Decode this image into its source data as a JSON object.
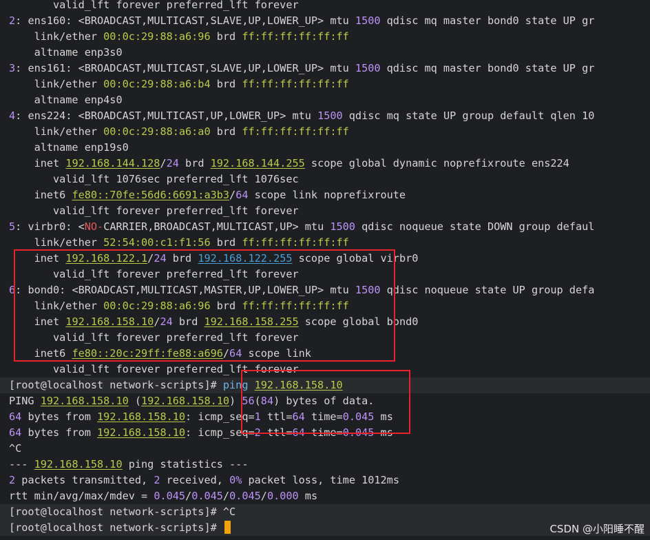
{
  "terminal": {
    "lines": [
      [
        [
          "d",
          "       valid_lft forever preferred_lft forever"
        ]
      ],
      [
        [
          "n",
          "2"
        ],
        [
          "d",
          ": ens160: <BROADCAST,MULTICAST,SLAVE,UP,LOWER_UP> mtu "
        ],
        [
          "n",
          "1500"
        ],
        [
          "d",
          " qdisc mq master bond0 state UP gr"
        ]
      ],
      [
        [
          "d",
          "    link/ether "
        ],
        [
          "g2",
          "00:0c:29:88:a6:96"
        ],
        [
          "d",
          " brd "
        ],
        [
          "g2",
          "ff:ff:ff:ff:ff:ff"
        ]
      ],
      [
        [
          "d",
          "    altname enp3s0"
        ]
      ],
      [
        [
          "n",
          "3"
        ],
        [
          "d",
          ": ens161: <BROADCAST,MULTICAST,SLAVE,UP,LOWER_UP> mtu "
        ],
        [
          "n",
          "1500"
        ],
        [
          "d",
          " qdisc mq master bond0 state UP gr"
        ]
      ],
      [
        [
          "d",
          "    link/ether "
        ],
        [
          "g2",
          "00:0c:29:88:a6:b4"
        ],
        [
          "d",
          " brd "
        ],
        [
          "g2",
          "ff:ff:ff:ff:ff:ff"
        ]
      ],
      [
        [
          "d",
          "    altname enp4s0"
        ]
      ],
      [
        [
          "n",
          "4"
        ],
        [
          "d",
          ": ens224: <BROADCAST,MULTICAST,UP,LOWER_UP> mtu "
        ],
        [
          "n",
          "1500"
        ],
        [
          "d",
          " qdisc mq state UP group default qlen 10"
        ]
      ],
      [
        [
          "d",
          "    link/ether "
        ],
        [
          "g2",
          "00:0c:29:88:a6:a0"
        ],
        [
          "d",
          " brd "
        ],
        [
          "g2",
          "ff:ff:ff:ff:ff:ff"
        ]
      ],
      [
        [
          "d",
          "    altname enp19s0"
        ]
      ],
      [
        [
          "d",
          "    inet "
        ],
        [
          "g",
          "192.168.144.128"
        ],
        [
          "d",
          "/"
        ],
        [
          "n",
          "24"
        ],
        [
          "d",
          " brd "
        ],
        [
          "g",
          "192.168.144.255"
        ],
        [
          "d",
          " scope global dynamic noprefixroute ens224"
        ]
      ],
      [
        [
          "d",
          "       valid_lft 1076sec preferred_lft 1076sec"
        ]
      ],
      [
        [
          "d",
          "    inet6 "
        ],
        [
          "g",
          "fe80::70fe:56d6:6691:a3b3"
        ],
        [
          "d",
          "/"
        ],
        [
          "n",
          "64"
        ],
        [
          "d",
          " scope link noprefixroute"
        ]
      ],
      [
        [
          "d",
          "       valid_lft forever preferred_lft forever"
        ]
      ],
      [
        [
          "n",
          "5"
        ],
        [
          "d",
          ": virbr0: <"
        ],
        [
          "r",
          "NO-"
        ],
        [
          "d",
          "CARRIER,BROADCAST,MULTICAST,UP> mtu "
        ],
        [
          "n",
          "1500"
        ],
        [
          "d",
          " qdisc noqueue state DOWN group defaul"
        ]
      ],
      [
        [
          "d",
          "    link/ether "
        ],
        [
          "g2",
          "52:54:00:c1:f1:56"
        ],
        [
          "d",
          " brd "
        ],
        [
          "g2",
          "ff:ff:ff:ff:ff:ff"
        ]
      ],
      [
        [
          "d",
          "    inet "
        ],
        [
          "g",
          "192.168.122.1"
        ],
        [
          "d",
          "/"
        ],
        [
          "n",
          "24"
        ],
        [
          "d",
          " brd "
        ],
        [
          "b",
          "192.168.122.255"
        ],
        [
          "d",
          " scope global virbr0"
        ]
      ],
      [
        [
          "d",
          "       valid_lft forever preferred_lft forever"
        ]
      ],
      [
        [
          "n",
          "6"
        ],
        [
          "d",
          ": bond0: <BROADCAST,MULTICAST,MASTER,UP,LOWER_UP> mtu "
        ],
        [
          "n",
          "1500"
        ],
        [
          "d",
          " qdisc noqueue state UP group defa"
        ]
      ],
      [
        [
          "d",
          "    link/ether "
        ],
        [
          "g2",
          "00:0c:29:88:a6:96"
        ],
        [
          "d",
          " brd "
        ],
        [
          "g2",
          "ff:ff:ff:ff:ff:ff"
        ]
      ],
      [
        [
          "d",
          "    inet "
        ],
        [
          "g",
          "192.168.158.10"
        ],
        [
          "d",
          "/"
        ],
        [
          "n",
          "24"
        ],
        [
          "d",
          " brd "
        ],
        [
          "g",
          "192.168.158.255"
        ],
        [
          "d",
          " scope global bond0"
        ]
      ],
      [
        [
          "d",
          "       valid_lft forever preferred_lft forever"
        ]
      ],
      [
        [
          "d",
          "    inet6 "
        ],
        [
          "g",
          "fe80::20c:29ff:fe88:a696"
        ],
        [
          "d",
          "/"
        ],
        [
          "n",
          "64"
        ],
        [
          "d",
          " scope link"
        ]
      ],
      [
        [
          "d",
          "       valid_lft forever preferred_lft forever"
        ]
      ],
      [
        [
          "d",
          "[root@localhost network-scripts]# "
        ],
        [
          "c",
          "ping "
        ],
        [
          "g",
          "192.168.158.10"
        ]
      ],
      [
        [
          "d",
          "PING "
        ],
        [
          "g",
          "192.168.158.10"
        ],
        [
          "d",
          " ("
        ],
        [
          "g",
          "192.168.158.10"
        ],
        [
          "d",
          ") "
        ],
        [
          "n",
          "56"
        ],
        [
          "d",
          "("
        ],
        [
          "n",
          "84"
        ],
        [
          "d",
          ") bytes of data."
        ]
      ],
      [
        [
          "n",
          "64"
        ],
        [
          "d",
          " bytes from "
        ],
        [
          "g",
          "192.168.158.10"
        ],
        [
          "d",
          ": icmp_seq="
        ],
        [
          "n",
          "1"
        ],
        [
          "d",
          " ttl="
        ],
        [
          "n",
          "64"
        ],
        [
          "d",
          " time="
        ],
        [
          "n",
          "0.045"
        ],
        [
          "d",
          " ms"
        ]
      ],
      [
        [
          "n",
          "64"
        ],
        [
          "d",
          " bytes from "
        ],
        [
          "g",
          "192.168.158.10"
        ],
        [
          "d",
          ": icmp_seq="
        ],
        [
          "n",
          "2"
        ],
        [
          "d",
          " ttl="
        ],
        [
          "n",
          "64"
        ],
        [
          "d",
          " time="
        ],
        [
          "n",
          "0.045"
        ],
        [
          "d",
          " ms"
        ]
      ],
      [
        [
          "d",
          "^C"
        ]
      ],
      [
        [
          "d",
          "--- "
        ],
        [
          "g",
          "192.168.158.10"
        ],
        [
          "d",
          " ping statistics ---"
        ]
      ],
      [
        [
          "n",
          "2"
        ],
        [
          "d",
          " packets transmitted, "
        ],
        [
          "n",
          "2"
        ],
        [
          "d",
          " received, "
        ],
        [
          "n",
          "0%"
        ],
        [
          "d",
          " packet loss, time 1012ms"
        ]
      ],
      [
        [
          "d",
          "rtt min/avg/max/mdev = "
        ],
        [
          "n",
          "0.045"
        ],
        [
          "d",
          "/"
        ],
        [
          "n",
          "0.045"
        ],
        [
          "d",
          "/"
        ],
        [
          "n",
          "0.045"
        ],
        [
          "d",
          "/"
        ],
        [
          "n",
          "0.000"
        ],
        [
          "d",
          " ms"
        ]
      ],
      [
        [
          "d",
          "[root@localhost network-scripts]# ^C"
        ]
      ],
      [
        [
          "d",
          "[root@localhost network-scripts]# "
        ]
      ]
    ],
    "highlighted_lines": [
      24,
      32,
      33
    ],
    "cursor_line": 33
  },
  "watermark": "CSDN @小阳睡不醒",
  "colors": {
    "background": "#1e1f22",
    "text": "#d6d6d6",
    "number": "#bd93f9",
    "address": "#b8cc4a",
    "annotation_box": "#e8212a",
    "cursor": "#f0a30a"
  }
}
